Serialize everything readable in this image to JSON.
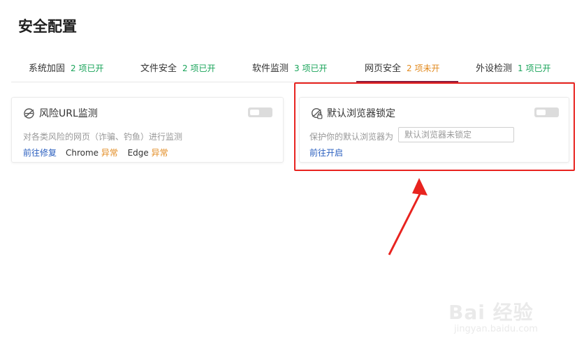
{
  "page": {
    "title": "安全配置"
  },
  "tabs": [
    {
      "label": "系统加固",
      "count": "2 项已开",
      "status": "on"
    },
    {
      "label": "文件安全",
      "count": "2 项已开",
      "status": "on"
    },
    {
      "label": "软件监测",
      "count": "3 项已开",
      "status": "on"
    },
    {
      "label": "网页安全",
      "count": "2 项未开",
      "status": "off",
      "active": true
    },
    {
      "label": "外设检测",
      "count": "1 项已开",
      "status": "on"
    }
  ],
  "cards": {
    "url_monitor": {
      "icon": "globe-icon",
      "title": "风险URL监测",
      "toggle": "off",
      "description": "对各类风险的网页（诈骗、钓鱼）进行监测",
      "action": "前往修复",
      "browsers": [
        {
          "name": "Chrome",
          "status": "异常"
        },
        {
          "name": "Edge",
          "status": "异常"
        }
      ]
    },
    "browser_lock": {
      "icon": "globe-lock-icon",
      "title": "默认浏览器锁定",
      "toggle": "off",
      "description": "保护你的默认浏览器为",
      "input_placeholder": "默认浏览器未锁定",
      "action": "前往开启"
    }
  },
  "colors": {
    "on": "#19a45a",
    "off": "#e28a1f",
    "link": "#2a5fbf",
    "active_tab": "#8a1c3c",
    "annotation": "#e8231f"
  },
  "watermark": {
    "main": "Bai 经验",
    "sub": "jingyan.baidu.com"
  }
}
